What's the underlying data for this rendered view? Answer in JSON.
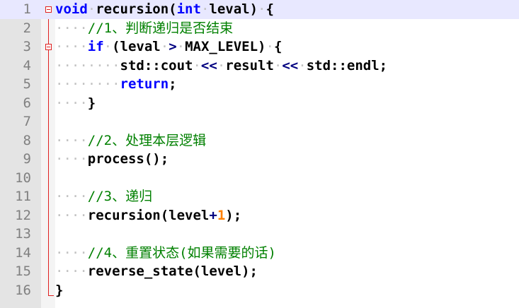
{
  "editor": {
    "lines": [
      {
        "n": "1",
        "highlight": true,
        "fold": true,
        "tokens": [
          {
            "t": "void",
            "c": "kw"
          },
          {
            "t": "·",
            "c": "ws"
          },
          {
            "t": "recursion(",
            "c": "tx"
          },
          {
            "t": "int",
            "c": "kw"
          },
          {
            "t": "·",
            "c": "ws"
          },
          {
            "t": "leval)",
            "c": "tx"
          },
          {
            "t": "·",
            "c": "ws"
          },
          {
            "t": "{",
            "c": "tx"
          }
        ]
      },
      {
        "n": "2",
        "highlight": false,
        "fold": false,
        "tokens": [
          {
            "t": "····",
            "c": "ws"
          },
          {
            "t": "//1、判断递归是否结束",
            "c": "cm"
          }
        ]
      },
      {
        "n": "3",
        "highlight": false,
        "fold": true,
        "tokens": [
          {
            "t": "····",
            "c": "ws"
          },
          {
            "t": "if",
            "c": "kw"
          },
          {
            "t": "·",
            "c": "ws"
          },
          {
            "t": "(leval",
            "c": "tx"
          },
          {
            "t": "·",
            "c": "ws"
          },
          {
            "t": ">",
            "c": "op"
          },
          {
            "t": "·",
            "c": "ws"
          },
          {
            "t": "MAX_LEVEL)",
            "c": "tx"
          },
          {
            "t": "·",
            "c": "ws"
          },
          {
            "t": "{",
            "c": "tx"
          }
        ]
      },
      {
        "n": "4",
        "highlight": false,
        "fold": false,
        "tokens": [
          {
            "t": "········",
            "c": "ws"
          },
          {
            "t": "std::cout",
            "c": "tx"
          },
          {
            "t": "·",
            "c": "ws"
          },
          {
            "t": "<<",
            "c": "op"
          },
          {
            "t": "·",
            "c": "ws"
          },
          {
            "t": "result",
            "c": "tx"
          },
          {
            "t": "·",
            "c": "ws"
          },
          {
            "t": "<<",
            "c": "op"
          },
          {
            "t": "·",
            "c": "ws"
          },
          {
            "t": "std::endl;",
            "c": "tx"
          }
        ]
      },
      {
        "n": "5",
        "highlight": false,
        "fold": false,
        "tokens": [
          {
            "t": "········",
            "c": "ws"
          },
          {
            "t": "return",
            "c": "kw"
          },
          {
            "t": ";",
            "c": "tx"
          }
        ]
      },
      {
        "n": "6",
        "highlight": false,
        "fold": false,
        "tokens": [
          {
            "t": "····",
            "c": "ws"
          },
          {
            "t": "}",
            "c": "tx"
          }
        ]
      },
      {
        "n": "7",
        "highlight": false,
        "fold": false,
        "tokens": []
      },
      {
        "n": "8",
        "highlight": false,
        "fold": false,
        "tokens": [
          {
            "t": "····",
            "c": "ws"
          },
          {
            "t": "//2、处理本层逻辑",
            "c": "cm"
          }
        ]
      },
      {
        "n": "9",
        "highlight": false,
        "fold": false,
        "tokens": [
          {
            "t": "····",
            "c": "ws"
          },
          {
            "t": "process();",
            "c": "tx"
          }
        ]
      },
      {
        "n": "10",
        "highlight": false,
        "fold": false,
        "tokens": []
      },
      {
        "n": "11",
        "highlight": false,
        "fold": false,
        "tokens": [
          {
            "t": "····",
            "c": "ws"
          },
          {
            "t": "//3、递归",
            "c": "cm"
          }
        ]
      },
      {
        "n": "12",
        "highlight": false,
        "fold": false,
        "tokens": [
          {
            "t": "····",
            "c": "ws"
          },
          {
            "t": "recursion(level",
            "c": "tx"
          },
          {
            "t": "+",
            "c": "op"
          },
          {
            "t": "1",
            "c": "num"
          },
          {
            "t": ");",
            "c": "tx"
          }
        ]
      },
      {
        "n": "13",
        "highlight": false,
        "fold": false,
        "tokens": []
      },
      {
        "n": "14",
        "highlight": false,
        "fold": false,
        "tokens": [
          {
            "t": "····",
            "c": "ws"
          },
          {
            "t": "//4、重置状态(如果需要的话)",
            "c": "cm"
          }
        ]
      },
      {
        "n": "15",
        "highlight": false,
        "fold": false,
        "tokens": [
          {
            "t": "····",
            "c": "ws"
          },
          {
            "t": "reverse_state(level);",
            "c": "tx"
          }
        ]
      },
      {
        "n": "16",
        "highlight": false,
        "fold": false,
        "tokens": [
          {
            "t": "}",
            "c": "tx"
          }
        ]
      }
    ],
    "colors": {
      "keyword": "#0000ff",
      "comment": "#008000",
      "number": "#ff8000",
      "operator": "#000080",
      "whitespace": "#c2c2c2",
      "fold_marker": "#e02020",
      "current_line": "#e8e8ff"
    }
  }
}
